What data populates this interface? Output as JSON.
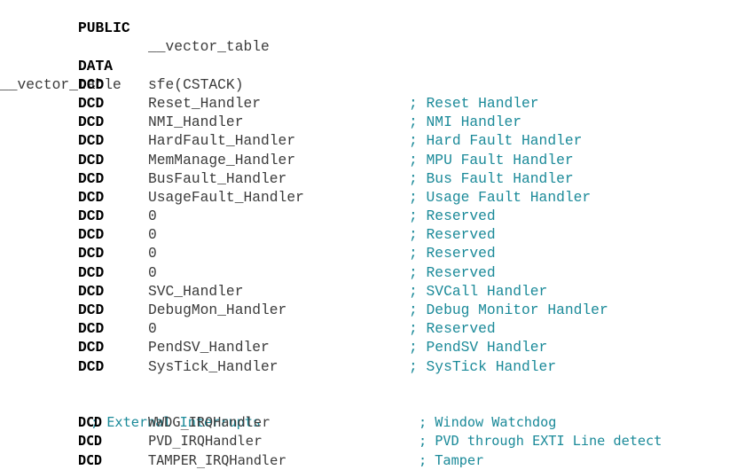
{
  "editor": {
    "background_color": "#ffffff",
    "keyword_color": "#000000",
    "operand_color": "#3b3b3b",
    "comment_color": "#1b8a99",
    "language": "arm-assembly"
  },
  "listing": {
    "header": {
      "public_keyword": "PUBLIC",
      "public_operand": "__vector_table",
      "data_keyword": "DATA",
      "label": "__vector_table"
    },
    "core_vectors": [
      {
        "keyword": "DCD",
        "operand": "sfe(CSTACK)",
        "comment": ""
      },
      {
        "keyword": "DCD",
        "operand": "Reset_Handler",
        "comment": "; Reset Handler"
      },
      {
        "keyword": "DCD",
        "operand": "NMI_Handler",
        "comment": "; NMI Handler"
      },
      {
        "keyword": "DCD",
        "operand": "HardFault_Handler",
        "comment": "; Hard Fault Handler"
      },
      {
        "keyword": "DCD",
        "operand": "MemManage_Handler",
        "comment": "; MPU Fault Handler"
      },
      {
        "keyword": "DCD",
        "operand": "BusFault_Handler",
        "comment": "; Bus Fault Handler"
      },
      {
        "keyword": "DCD",
        "operand": "UsageFault_Handler",
        "comment": "; Usage Fault Handler"
      },
      {
        "keyword": "DCD",
        "operand": "0",
        "comment": "; Reserved"
      },
      {
        "keyword": "DCD",
        "operand": "0",
        "comment": "; Reserved"
      },
      {
        "keyword": "DCD",
        "operand": "0",
        "comment": "; Reserved"
      },
      {
        "keyword": "DCD",
        "operand": "0",
        "comment": "; Reserved"
      },
      {
        "keyword": "DCD",
        "operand": "SVC_Handler",
        "comment": "; SVCall Handler"
      },
      {
        "keyword": "DCD",
        "operand": "DebugMon_Handler",
        "comment": "; Debug Monitor Handler"
      },
      {
        "keyword": "DCD",
        "operand": "0",
        "comment": "; Reserved"
      },
      {
        "keyword": "DCD",
        "operand": "PendSV_Handler",
        "comment": "; PendSV Handler"
      },
      {
        "keyword": "DCD",
        "operand": "SysTick_Handler",
        "comment": "; SysTick Handler"
      }
    ],
    "external_section_comment": "; External Interrupts",
    "external_vectors": [
      {
        "keyword": "DCD",
        "operand": "WWDG_IRQHandler",
        "comment": "; Window Watchdog"
      },
      {
        "keyword": "DCD",
        "operand": "PVD_IRQHandler",
        "comment": "; PVD through EXTI Line detect"
      },
      {
        "keyword": "DCD",
        "operand": "TAMPER_IRQHandler",
        "comment": "; Tamper"
      }
    ]
  }
}
